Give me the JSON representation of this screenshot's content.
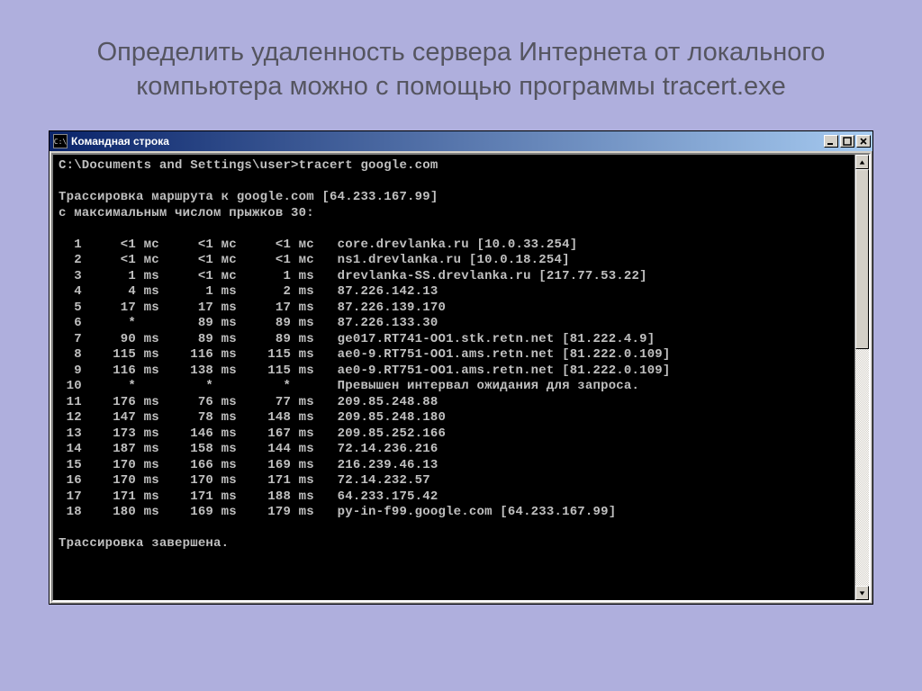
{
  "slide": {
    "title": "Определить удаленность сервера Интернета от локального компьютера можно с помощью программы tracert.exe"
  },
  "window": {
    "title": "Командная строка",
    "icon_label": "C:\\"
  },
  "console": {
    "prompt": "C:\\Documents and Settings\\user>tracert google.com",
    "header1": "Трассировка маршрута к google.com [64.233.167.99]",
    "header2": "с максимальным числом прыжков 30:",
    "footer": "Трассировка завершена.",
    "hops": [
      {
        "n": "1",
        "t1": "<1",
        "u1": "мс",
        "t2": "<1",
        "u2": "мс",
        "t3": "<1",
        "u3": "мс",
        "host": "core.drevlanka.ru [10.0.33.254]"
      },
      {
        "n": "2",
        "t1": "<1",
        "u1": "мс",
        "t2": "<1",
        "u2": "мс",
        "t3": "<1",
        "u3": "мс",
        "host": "ns1.drevlanka.ru [10.0.18.254]"
      },
      {
        "n": "3",
        "t1": "1",
        "u1": "ms",
        "t2": "<1",
        "u2": "мс",
        "t3": "1",
        "u3": "ms",
        "host": "drevlanka-SS.drevlanka.ru [217.77.53.22]"
      },
      {
        "n": "4",
        "t1": "4",
        "u1": "ms",
        "t2": "1",
        "u2": "ms",
        "t3": "2",
        "u3": "ms",
        "host": "87.226.142.13"
      },
      {
        "n": "5",
        "t1": "17",
        "u1": "ms",
        "t2": "17",
        "u2": "ms",
        "t3": "17",
        "u3": "ms",
        "host": "87.226.139.170"
      },
      {
        "n": "6",
        "t1": "*",
        "u1": "",
        "t2": "89",
        "u2": "ms",
        "t3": "89",
        "u3": "ms",
        "host": "87.226.133.30"
      },
      {
        "n": "7",
        "t1": "90",
        "u1": "ms",
        "t2": "89",
        "u2": "ms",
        "t3": "89",
        "u3": "ms",
        "host": "ge017.RT741-OO1.stk.retn.net [81.222.4.9]"
      },
      {
        "n": "8",
        "t1": "115",
        "u1": "ms",
        "t2": "116",
        "u2": "ms",
        "t3": "115",
        "u3": "ms",
        "host": "ae0-9.RT751-OO1.ams.retn.net [81.222.0.109]"
      },
      {
        "n": "9",
        "t1": "116",
        "u1": "ms",
        "t2": "138",
        "u2": "ms",
        "t3": "115",
        "u3": "ms",
        "host": "ae0-9.RT751-OO1.ams.retn.net [81.222.0.109]"
      },
      {
        "n": "10",
        "t1": "*",
        "u1": "",
        "t2": "*",
        "u2": "",
        "t3": "*",
        "u3": "",
        "host": "Превышен интервал ожидания для запроса."
      },
      {
        "n": "11",
        "t1": "176",
        "u1": "ms",
        "t2": "76",
        "u2": "ms",
        "t3": "77",
        "u3": "ms",
        "host": "209.85.248.88"
      },
      {
        "n": "12",
        "t1": "147",
        "u1": "ms",
        "t2": "78",
        "u2": "ms",
        "t3": "148",
        "u3": "ms",
        "host": "209.85.248.180"
      },
      {
        "n": "13",
        "t1": "173",
        "u1": "ms",
        "t2": "146",
        "u2": "ms",
        "t3": "167",
        "u3": "ms",
        "host": "209.85.252.166"
      },
      {
        "n": "14",
        "t1": "187",
        "u1": "ms",
        "t2": "158",
        "u2": "ms",
        "t3": "144",
        "u3": "ms",
        "host": "72.14.236.216"
      },
      {
        "n": "15",
        "t1": "170",
        "u1": "ms",
        "t2": "166",
        "u2": "ms",
        "t3": "169",
        "u3": "ms",
        "host": "216.239.46.13"
      },
      {
        "n": "16",
        "t1": "170",
        "u1": "ms",
        "t2": "170",
        "u2": "ms",
        "t3": "171",
        "u3": "ms",
        "host": "72.14.232.57"
      },
      {
        "n": "17",
        "t1": "171",
        "u1": "ms",
        "t2": "171",
        "u2": "ms",
        "t3": "188",
        "u3": "ms",
        "host": "64.233.175.42"
      },
      {
        "n": "18",
        "t1": "180",
        "u1": "ms",
        "t2": "169",
        "u2": "ms",
        "t3": "179",
        "u3": "ms",
        "host": "py-in-f99.google.com [64.233.167.99]"
      }
    ]
  }
}
